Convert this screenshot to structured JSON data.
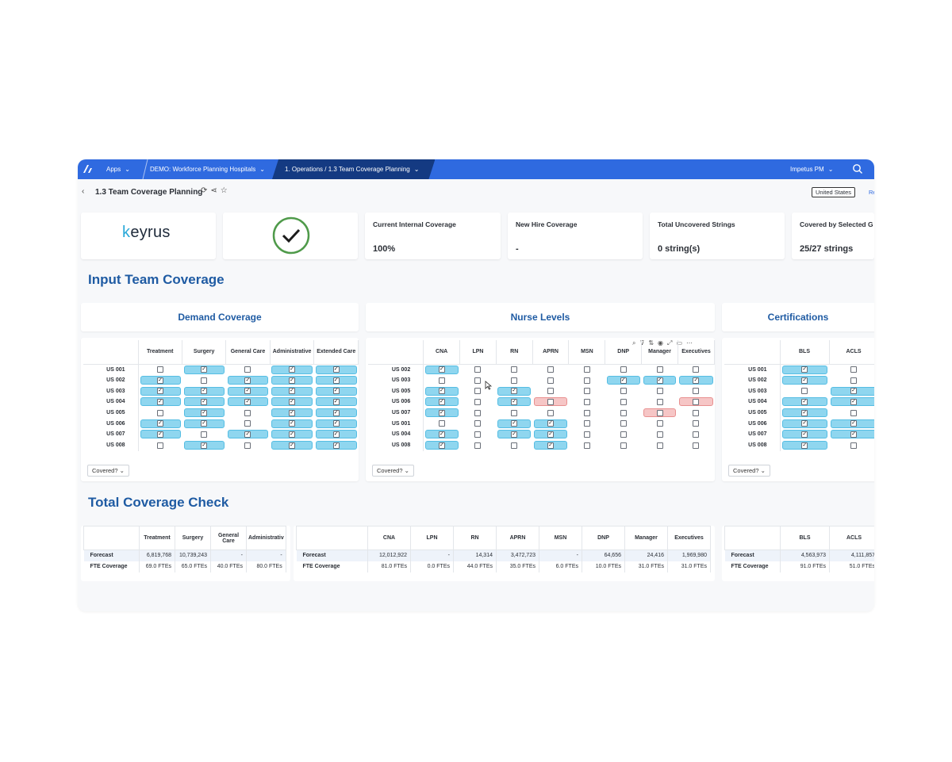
{
  "topbar": {
    "apps_label": "Apps",
    "demo_label": "DEMO: Workforce Planning Hospitals",
    "section_label": "1. Operations / 1.3 Team Coverage Planning",
    "user_label": "Impetus PM"
  },
  "subheader": {
    "title": "1.3 Team Coverage Planning",
    "region": "United States",
    "region2": "Re"
  },
  "kpis": {
    "logo_text": "keyrus",
    "current_internal": {
      "label": "Current Internal Coverage",
      "value": "100%"
    },
    "new_hire": {
      "label": "New Hire Coverage",
      "value": "-"
    },
    "uncovered": {
      "label": "Total Uncovered Strings",
      "value": "0 string(s)"
    },
    "covered_selected": {
      "label": "Covered by Selected G",
      "value": "25/27 strings"
    }
  },
  "sections": {
    "input_title": "Input Team Coverage",
    "total_title": "Total Coverage Check"
  },
  "panels": {
    "demand_title": "Demand Coverage",
    "nurse_title": "Nurse Levels",
    "cert_title": "Certifications",
    "covered_filter": "Covered?"
  },
  "demand": {
    "columns": [
      "Treatment",
      "Surgery",
      "General Care",
      "Administrative",
      "Extended Care"
    ],
    "rows": [
      {
        "label": "US 001",
        "cells": [
          "u",
          "c",
          "u",
          "c",
          "c"
        ]
      },
      {
        "label": "US 002",
        "cells": [
          "c",
          "u",
          "c",
          "c",
          "c"
        ]
      },
      {
        "label": "US 003",
        "cells": [
          "c",
          "c",
          "c",
          "c",
          "c"
        ]
      },
      {
        "label": "US 004",
        "cells": [
          "c",
          "c",
          "c",
          "c",
          "c"
        ]
      },
      {
        "label": "US 005",
        "cells": [
          "u",
          "c",
          "u",
          "c",
          "c"
        ]
      },
      {
        "label": "US 006",
        "cells": [
          "c",
          "c",
          "u",
          "c",
          "c"
        ]
      },
      {
        "label": "US 007",
        "cells": [
          "c",
          "u",
          "c",
          "c",
          "c"
        ]
      },
      {
        "label": "US 008",
        "cells": [
          "u",
          "c",
          "u",
          "c",
          "c"
        ]
      }
    ]
  },
  "nurse": {
    "columns": [
      "CNA",
      "LPN",
      "RN",
      "APRN",
      "MSN",
      "DNP",
      "Manager",
      "Executives"
    ],
    "rows": [
      {
        "label": "US 002",
        "cells": [
          "c",
          "u",
          "u",
          "u",
          "u",
          "u",
          "u",
          "u"
        ]
      },
      {
        "label": "US 003",
        "cells": [
          "u",
          "u",
          "u",
          "u",
          "u",
          "c",
          "c",
          "c"
        ]
      },
      {
        "label": "US 005",
        "cells": [
          "c",
          "u",
          "c",
          "u",
          "u",
          "u",
          "u",
          "u"
        ]
      },
      {
        "label": "US 006",
        "cells": [
          "c",
          "u",
          "c",
          "r",
          "u",
          "u",
          "u",
          "r"
        ]
      },
      {
        "label": "US 007",
        "cells": [
          "c",
          "u",
          "u",
          "u",
          "u",
          "u",
          "r",
          "u"
        ]
      },
      {
        "label": "US 001",
        "cells": [
          "u",
          "u",
          "c",
          "c",
          "u",
          "u",
          "u",
          "u"
        ]
      },
      {
        "label": "US 004",
        "cells": [
          "c",
          "u",
          "c",
          "c",
          "u",
          "u",
          "u",
          "u"
        ]
      },
      {
        "label": "US 008",
        "cells": [
          "c",
          "u",
          "u",
          "c",
          "u",
          "u",
          "u",
          "u"
        ]
      }
    ]
  },
  "cert": {
    "columns": [
      "BLS",
      "ACLS"
    ],
    "rows": [
      {
        "label": "US 001",
        "cells": [
          "c",
          "u"
        ]
      },
      {
        "label": "US 002",
        "cells": [
          "c",
          "u"
        ]
      },
      {
        "label": "US 003",
        "cells": [
          "u",
          "c"
        ]
      },
      {
        "label": "US 004",
        "cells": [
          "c",
          "c"
        ]
      },
      {
        "label": "US 005",
        "cells": [
          "c",
          "u"
        ]
      },
      {
        "label": "US 006",
        "cells": [
          "c",
          "c"
        ]
      },
      {
        "label": "US 007",
        "cells": [
          "c",
          "c"
        ]
      },
      {
        "label": "US 008",
        "cells": [
          "c",
          "u"
        ]
      }
    ]
  },
  "totals_demand": {
    "columns": [
      "Treatment",
      "Surgery",
      "General Care",
      "Administrativ"
    ],
    "forecast_label": "Forecast",
    "fte_label": "FTE Coverage",
    "forecast": [
      "6,819,768",
      "10,739,243",
      "-",
      "-"
    ],
    "fte": [
      "69.0 FTEs",
      "65.0 FTEs",
      "40.0 FTEs",
      "80.0 FTEs"
    ]
  },
  "totals_nurse": {
    "columns": [
      "CNA",
      "LPN",
      "RN",
      "APRN",
      "MSN",
      "DNP",
      "Manager",
      "Executives"
    ],
    "forecast_label": "Forecast",
    "fte_label": "FTE Coverage",
    "forecast": [
      "12,012,922",
      "-",
      "14,314",
      "3,472,723",
      "-",
      "64,656",
      "24,416",
      "1,969,980"
    ],
    "fte": [
      "81.0 FTEs",
      "0.0 FTEs",
      "44.0 FTEs",
      "35.0 FTEs",
      "6.0 FTEs",
      "10.0 FTEs",
      "31.0 FTEs",
      "31.0 FTEs"
    ]
  },
  "totals_cert": {
    "columns": [
      "BLS",
      "ACLS"
    ],
    "forecast_label": "Forecast",
    "fte_label": "FTE Coverage",
    "forecast": [
      "4,563,973",
      "4,111,857"
    ],
    "fte": [
      "91.0 FTEs",
      "51.0 FTEs"
    ]
  },
  "colors": {
    "accent": "#2f6ae0",
    "nav_dark": "#143a82",
    "title_blue": "#1f5ba3",
    "covered_cell": "#8fd6ef",
    "gap_cell": "#f6c6c6",
    "check_green": "#4f9a4a"
  }
}
